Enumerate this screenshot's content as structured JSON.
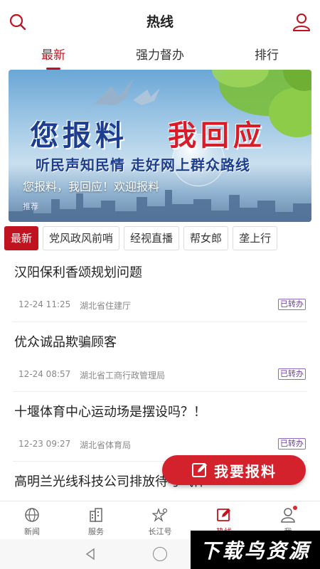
{
  "header": {
    "title": "热线",
    "search_icon": "search-icon",
    "user_icon": "user-icon"
  },
  "top_tabs": [
    {
      "label": "最新",
      "active": true
    },
    {
      "label": "强力督办",
      "active": false
    },
    {
      "label": "排行",
      "active": false
    }
  ],
  "banner": {
    "headline_left": "您报料",
    "headline_right": "我回应",
    "slogan": "听民声知民情  走好网上群众路线",
    "caption": "您报料，我回应！欢迎报料",
    "tag": "推荐"
  },
  "chips": [
    {
      "label": "最新",
      "active": true
    },
    {
      "label": "党风政风前哨",
      "active": false
    },
    {
      "label": "经视直播",
      "active": false
    },
    {
      "label": "帮女郎",
      "active": false
    },
    {
      "label": "垄上行",
      "active": false
    }
  ],
  "items": [
    {
      "title": "汉阳保利香颂规划问题",
      "time": "12-24 11:25",
      "dept": "湖北省住建厅",
      "badge": "已转办"
    },
    {
      "title": "优众诚品欺骗顾客",
      "time": "12-24 08:57",
      "dept": "湖北省工商行政管理局",
      "badge": "已转办"
    },
    {
      "title": "十堰体育中心运动场是摆设吗？！",
      "time": "12-23 09:27",
      "dept": "湖北省体育局",
      "badge": "已转办"
    },
    {
      "title": "高明兰光线科技公司排放待考气体"
    }
  ],
  "report_button": {
    "label": "我要报料"
  },
  "bottom_nav": [
    {
      "label": "新闻",
      "icon": "globe-icon",
      "active": false
    },
    {
      "label": "服务",
      "icon": "building-icon",
      "active": false
    },
    {
      "label": "长江号",
      "icon": "star-icon",
      "active": false
    },
    {
      "label": "热线",
      "icon": "edit-icon",
      "active": true
    },
    {
      "label": "我",
      "icon": "user-icon",
      "active": false
    }
  ],
  "watermark": "下载鸟资源",
  "colors": {
    "accent": "#c1121f",
    "badge": "#6a3d9a"
  }
}
